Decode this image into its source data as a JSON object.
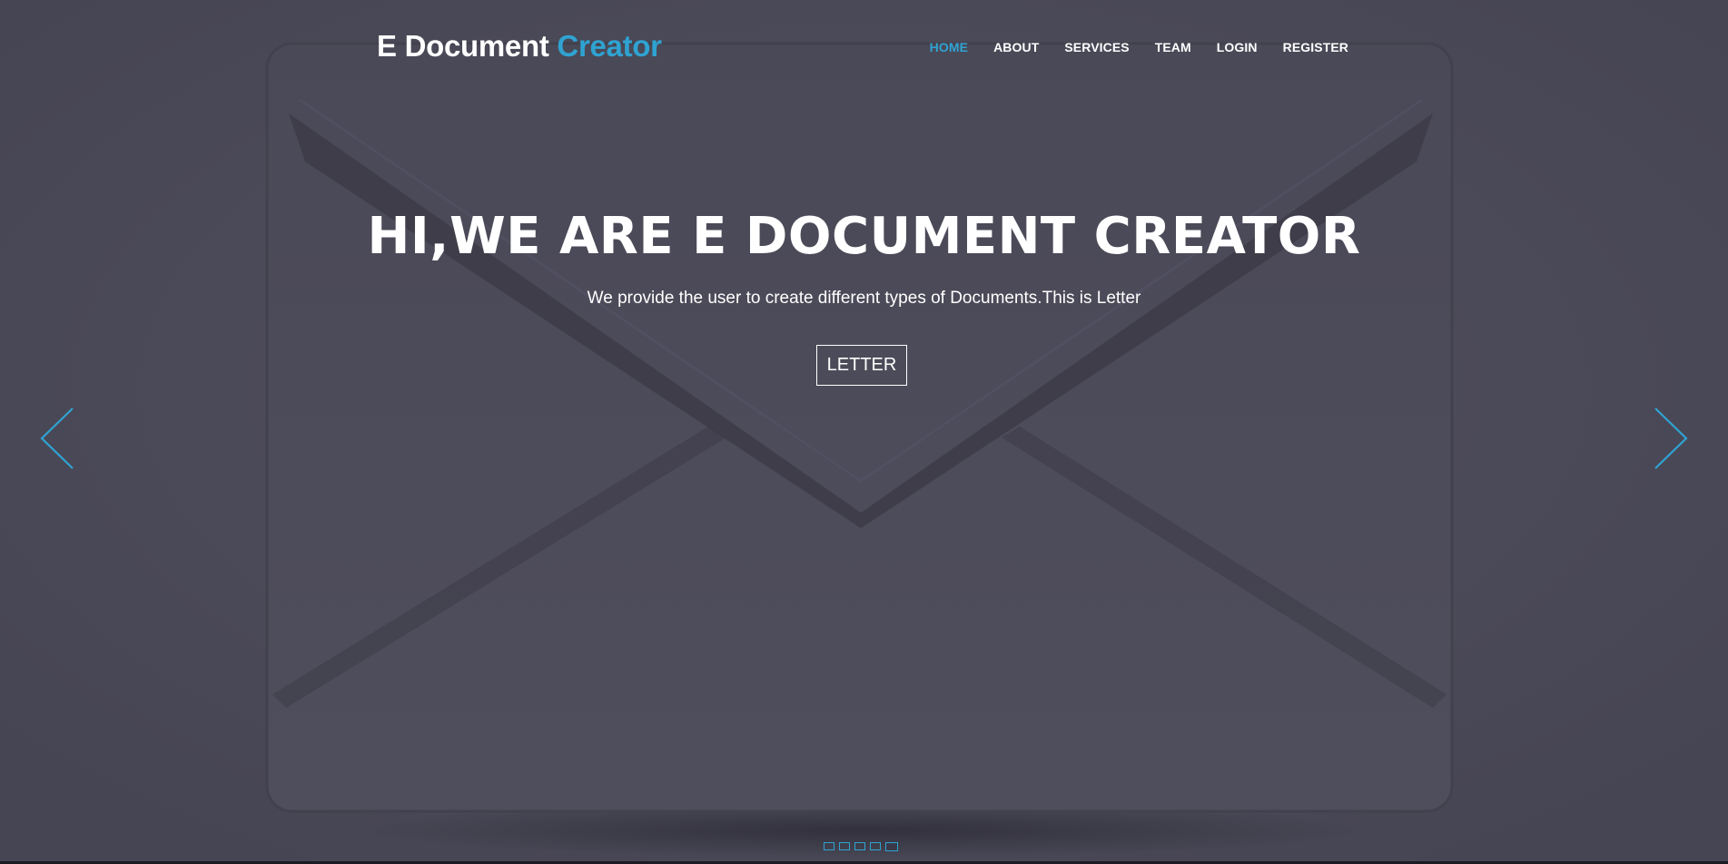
{
  "brand": {
    "part1": "E Document",
    "part2": "Creator"
  },
  "nav": {
    "items": [
      {
        "label": "HOME"
      },
      {
        "label": "ABOUT"
      },
      {
        "label": "SERVICES"
      },
      {
        "label": "TEAM"
      },
      {
        "label": "LOGIN"
      },
      {
        "label": "REGISTER"
      }
    ]
  },
  "hero": {
    "headline": "HI,WE ARE E DOCUMENT CREATOR",
    "subline": "We provide the user to create different types of Documents.This is Letter",
    "cta_label": "LETTER"
  },
  "carousel": {
    "active_slide": 5,
    "slide_count": 5
  },
  "colors": {
    "accent": "#2fa3d2",
    "background": "#4c4b5a",
    "text": "#ffffff"
  }
}
